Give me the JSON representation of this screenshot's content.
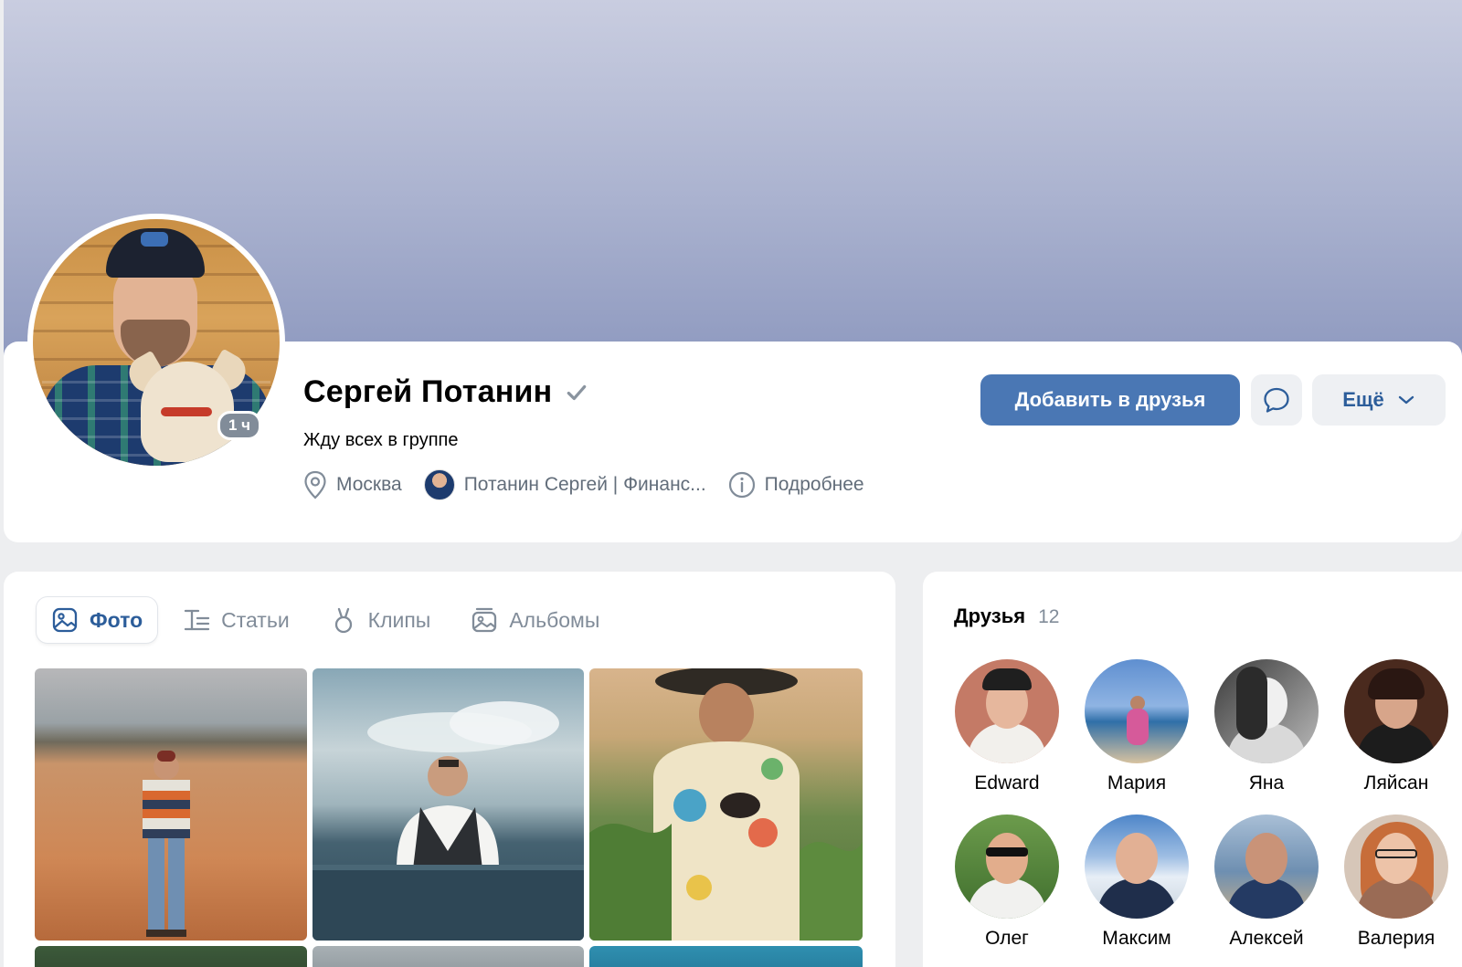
{
  "profile": {
    "name": "Сергей Потанин",
    "status": "Жду всех в группе",
    "online_badge": "1 ч",
    "city": "Москва",
    "work": "Потанин Сергей | Финанс...",
    "details_label": "Подробнее"
  },
  "actions": {
    "add_friend_label": "Добавить в друзья",
    "more_label": "Ещё"
  },
  "media_tabs": [
    {
      "label": "Фото",
      "icon": "image-icon",
      "active": true
    },
    {
      "label": "Статьи",
      "icon": "articles-icon",
      "active": false
    },
    {
      "label": "Клипы",
      "icon": "clips-icon",
      "active": false
    },
    {
      "label": "Альбомы",
      "icon": "albums-icon",
      "active": false
    }
  ],
  "friends": {
    "title": "Друзья",
    "count": "12",
    "items": [
      {
        "name": "Edward"
      },
      {
        "name": "Мария"
      },
      {
        "name": "Яна"
      },
      {
        "name": "Ляйсан"
      },
      {
        "name": "Олег"
      },
      {
        "name": "Максим"
      },
      {
        "name": "Алексей"
      },
      {
        "name": "Валерия"
      }
    ]
  },
  "colors": {
    "accent": "#4a77b4",
    "link": "#2c5d9a",
    "secondary_text": "#818c99",
    "page_background": "#edeef0"
  }
}
